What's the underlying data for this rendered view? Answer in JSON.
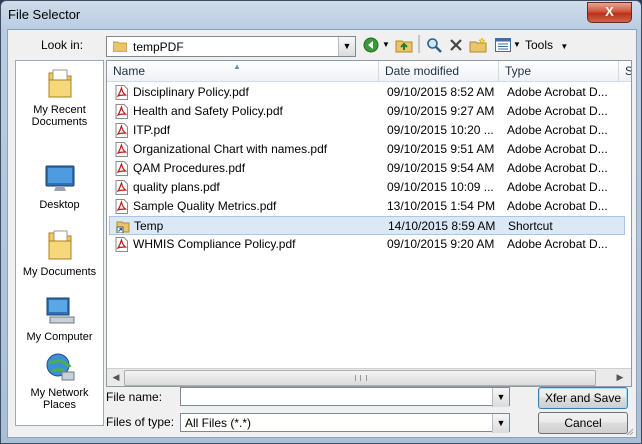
{
  "window": {
    "title": "File Selector",
    "close_label": "X"
  },
  "toolbar": {
    "look_in_label": "Look in:",
    "look_in_value": "tempPDF",
    "tools_label": "Tools"
  },
  "places": [
    {
      "label": "My Recent Documents",
      "icon": "recent-documents-icon"
    },
    {
      "label": "Desktop",
      "icon": "desktop-icon"
    },
    {
      "label": "My Documents",
      "icon": "my-documents-icon"
    },
    {
      "label": "My Computer",
      "icon": "my-computer-icon"
    },
    {
      "label": "My Network Places",
      "icon": "network-places-icon"
    }
  ],
  "columns": {
    "name": "Name",
    "date": "Date modified",
    "type": "Type",
    "size": "S"
  },
  "files": [
    {
      "name": "Disciplinary Policy.pdf",
      "date": "09/10/2015 8:52 AM",
      "type": "Adobe Acrobat D...",
      "icon": "pdf-icon"
    },
    {
      "name": "Health and Safety Policy.pdf",
      "date": "09/10/2015 9:27 AM",
      "type": "Adobe Acrobat D...",
      "icon": "pdf-icon"
    },
    {
      "name": "ITP.pdf",
      "date": "09/10/2015 10:20 ...",
      "type": "Adobe Acrobat D...",
      "icon": "pdf-icon"
    },
    {
      "name": "Organizational Chart with names.pdf",
      "date": "09/10/2015 9:51 AM",
      "type": "Adobe Acrobat D...",
      "icon": "pdf-icon"
    },
    {
      "name": "QAM Procedures.pdf",
      "date": "09/10/2015 9:54 AM",
      "type": "Adobe Acrobat D...",
      "icon": "pdf-icon"
    },
    {
      "name": "quality plans.pdf",
      "date": "09/10/2015 10:09 ...",
      "type": "Adobe Acrobat D...",
      "icon": "pdf-icon"
    },
    {
      "name": "Sample Quality Metrics.pdf",
      "date": "13/10/2015 1:54 PM",
      "type": "Adobe Acrobat D...",
      "icon": "pdf-icon"
    },
    {
      "name": "Temp",
      "date": "14/10/2015 8:59 AM",
      "type": "Shortcut",
      "icon": "shortcut-icon",
      "selected": true
    },
    {
      "name": "WHMIS Compliance Policy.pdf",
      "date": "09/10/2015 9:20 AM",
      "type": "Adobe Acrobat D...",
      "icon": "pdf-icon"
    }
  ],
  "footer": {
    "file_name_label": "File name:",
    "file_name_value": "",
    "file_type_label": "Files of type:",
    "file_type_value": "All Files (*.*)",
    "save_button": "Xfer and Save",
    "cancel_button": "Cancel"
  }
}
